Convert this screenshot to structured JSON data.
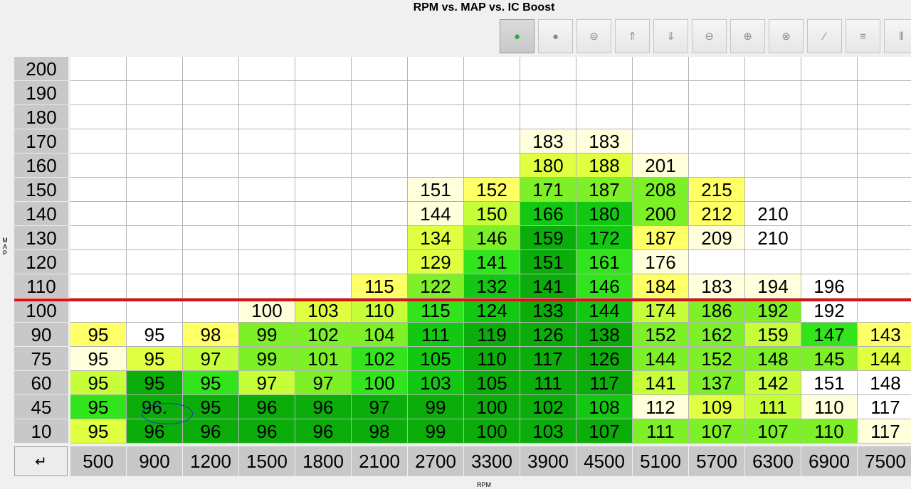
{
  "title": "RPM vs. MAP vs. IC Boost",
  "y_axis_label": "MAP",
  "x_axis_label": "RPM",
  "corner_button": "↵",
  "toolbar": [
    {
      "name": "refresh-icon",
      "glyph": "●",
      "active": true
    },
    {
      "name": "record-icon",
      "glyph": "●"
    },
    {
      "name": "equal-icon",
      "glyph": "⊜"
    },
    {
      "name": "upload-icon",
      "glyph": "⇑"
    },
    {
      "name": "download-icon",
      "glyph": "⇓"
    },
    {
      "name": "minus-icon",
      "glyph": "⊖"
    },
    {
      "name": "plus-icon",
      "glyph": "⊕"
    },
    {
      "name": "multiply-icon",
      "glyph": "⊗"
    },
    {
      "name": "pencil-icon",
      "glyph": "∕"
    },
    {
      "name": "menu-icon",
      "glyph": "≡"
    },
    {
      "name": "columns-icon",
      "glyph": "⦀"
    }
  ],
  "rpm": [
    "500",
    "900",
    "1200",
    "1500",
    "1800",
    "2100",
    "2700",
    "3300",
    "3900",
    "4500",
    "5100",
    "5700",
    "6300",
    "6900",
    "7500"
  ],
  "map": [
    "200",
    "190",
    "180",
    "170",
    "160",
    "150",
    "140",
    "130",
    "120",
    "110",
    "100",
    "90",
    "75",
    "60",
    "45",
    "10"
  ],
  "cells": [
    [
      "",
      "",
      "",
      "",
      "",
      "",
      "",
      "",
      "",
      "",
      "",
      "",
      "",
      "",
      ""
    ],
    [
      "",
      "",
      "",
      "",
      "",
      "",
      "",
      "",
      "",
      "",
      "",
      "",
      "",
      "",
      ""
    ],
    [
      "",
      "",
      "",
      "",
      "",
      "",
      "",
      "",
      "",
      "",
      "",
      "",
      "",
      "",
      ""
    ],
    [
      "",
      "",
      "",
      "",
      "",
      "",
      "",
      "",
      "183",
      "183",
      "",
      "",
      "",
      "",
      ""
    ],
    [
      "",
      "",
      "",
      "",
      "",
      "",
      "",
      "",
      "180",
      "188",
      "201",
      "",
      "",
      "",
      ""
    ],
    [
      "",
      "",
      "",
      "",
      "",
      "",
      "151",
      "152",
      "171",
      "187",
      "208",
      "215",
      "",
      "",
      ""
    ],
    [
      "",
      "",
      "",
      "",
      "",
      "",
      "144",
      "150",
      "166",
      "180",
      "200",
      "212",
      "210",
      "",
      ""
    ],
    [
      "",
      "",
      "",
      "",
      "",
      "",
      "134",
      "146",
      "159",
      "172",
      "187",
      "209",
      "210",
      "",
      ""
    ],
    [
      "",
      "",
      "",
      "",
      "",
      "",
      "129",
      "141",
      "151",
      "161",
      "176",
      "",
      "",
      "",
      ""
    ],
    [
      "",
      "",
      "",
      "",
      "",
      "115",
      "122",
      "132",
      "141",
      "146",
      "184",
      "183",
      "194",
      "196",
      ""
    ],
    [
      "",
      "",
      "",
      "100",
      "103",
      "110",
      "115",
      "124",
      "133",
      "144",
      "174",
      "186",
      "192",
      "192",
      ""
    ],
    [
      "95",
      "95",
      "98",
      "99",
      "102",
      "104",
      "111",
      "119",
      "126",
      "138",
      "152",
      "162",
      "159",
      "147",
      "143"
    ],
    [
      "95",
      "95",
      "97",
      "99",
      "101",
      "102",
      "105",
      "110",
      "117",
      "126",
      "144",
      "152",
      "148",
      "145",
      "144"
    ],
    [
      "95",
      "95",
      "95",
      "97",
      "97",
      "100",
      "103",
      "105",
      "111",
      "117",
      "141",
      "137",
      "142",
      "151",
      "148"
    ],
    [
      "95",
      "96.",
      "95",
      "96",
      "96",
      "97",
      "99",
      "100",
      "102",
      "108",
      "112",
      "109",
      "111",
      "110",
      "117"
    ],
    [
      "95",
      "96",
      "96",
      "96",
      "96",
      "98",
      "99",
      "100",
      "103",
      "107",
      "111",
      "107",
      "107",
      "110",
      "117"
    ]
  ],
  "colors": {
    "empty": "#ffffff",
    "palette": [
      "#ffffdc",
      "#ffff66",
      "#e0ff40",
      "#c6ff3a",
      "#7ef028",
      "#32e41c",
      "#12c812",
      "#0aad0a"
    ],
    "shades": [
      [
        0,
        0,
        0,
        0,
        0,
        0,
        0,
        0,
        0,
        0,
        0,
        0,
        0,
        0,
        0
      ],
      [
        0,
        0,
        0,
        0,
        0,
        0,
        0,
        0,
        0,
        0,
        0,
        0,
        0,
        0,
        0
      ],
      [
        0,
        0,
        0,
        0,
        0,
        0,
        0,
        0,
        0,
        0,
        0,
        0,
        0,
        0,
        0
      ],
      [
        0,
        0,
        0,
        0,
        0,
        0,
        0,
        0,
        1,
        1,
        0,
        0,
        0,
        0,
        0
      ],
      [
        0,
        0,
        0,
        0,
        0,
        0,
        0,
        0,
        3,
        3,
        1,
        0,
        0,
        0,
        0
      ],
      [
        0,
        0,
        0,
        0,
        0,
        0,
        1,
        2,
        5,
        5,
        5,
        2,
        0,
        0,
        0
      ],
      [
        0,
        0,
        0,
        0,
        0,
        0,
        1,
        4,
        7,
        7,
        5,
        2,
        0,
        0,
        0
      ],
      [
        0,
        0,
        0,
        0,
        0,
        0,
        3,
        5,
        8,
        7,
        2,
        1,
        0,
        0,
        0
      ],
      [
        0,
        0,
        0,
        0,
        0,
        0,
        3,
        6,
        8,
        6,
        1,
        0,
        0,
        0,
        0
      ],
      [
        0,
        0,
        0,
        0,
        0,
        2,
        5,
        7,
        8,
        6,
        2,
        1,
        1,
        0,
        0
      ],
      [
        0,
        0,
        0,
        1,
        3,
        4,
        6,
        7,
        8,
        7,
        4,
        5,
        5,
        0,
        0
      ],
      [
        2,
        0,
        2,
        5,
        5,
        5,
        7,
        8,
        8,
        8,
        5,
        5,
        4,
        6,
        2
      ],
      [
        1,
        3,
        4,
        5,
        5,
        6,
        7,
        8,
        8,
        8,
        5,
        5,
        5,
        5,
        3
      ],
      [
        4,
        8,
        6,
        4,
        5,
        6,
        7,
        8,
        8,
        8,
        4,
        5,
        4,
        0,
        0
      ],
      [
        6,
        8,
        8,
        8,
        8,
        8,
        8,
        8,
        8,
        7,
        1,
        3,
        4,
        1,
        0
      ],
      [
        3,
        8,
        8,
        8,
        8,
        8,
        8,
        8,
        8,
        8,
        5,
        5,
        5,
        5,
        1
      ]
    ]
  }
}
